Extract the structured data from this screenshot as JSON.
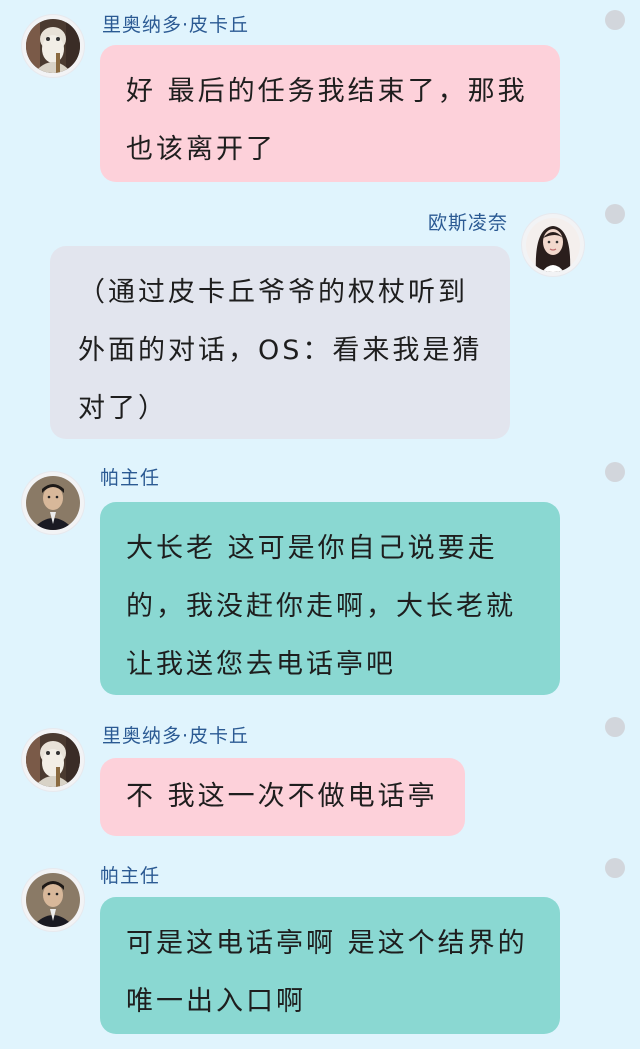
{
  "chat": {
    "messages": [
      {
        "sender": "里奥纳多·皮卡丘",
        "side": "left",
        "bubble_color": "#fdd1da",
        "lines": [
          "好 最后的任务我结束了，那我",
          "也该离开了"
        ]
      },
      {
        "sender": "欧斯凌奈",
        "side": "right",
        "bubble_color": "#e2e5ee",
        "lines": [
          "（通过皮卡丘爷爷的权杖听到",
          "外面的对话，OS：看来我是猜",
          "对了）"
        ]
      },
      {
        "sender": "帕主任",
        "side": "left",
        "bubble_color": "#8ad8d2",
        "lines": [
          "大长老 这可是你自己说要走",
          "的，我没赶你走啊，大长老就",
          "让我送您去电话亭吧"
        ]
      },
      {
        "sender": "里奥纳多·皮卡丘",
        "side": "left",
        "bubble_color": "#fdd1da",
        "lines": [
          "不 我这一次不做电话亭"
        ]
      },
      {
        "sender": "帕主任",
        "side": "left",
        "bubble_color": "#8ad8d2",
        "lines": [
          "可是这电话亭啊 是这个结界的",
          "唯一出入口啊"
        ]
      }
    ]
  },
  "colors": {
    "background": "#e0f4fd",
    "name_text": "#2b5a93",
    "message_text": "#1e1e1e",
    "dot": "#d2d6dc"
  },
  "icons": [
    "avatar-pikachu-elder",
    "avatar-oslingnai",
    "avatar-director-pa",
    "more-dot"
  ]
}
